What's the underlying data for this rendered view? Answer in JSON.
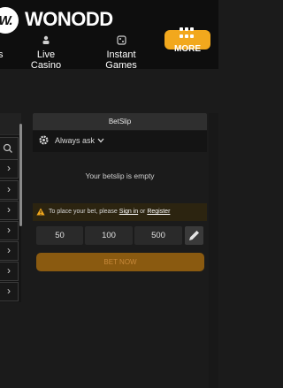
{
  "brand": {
    "mark": "W.",
    "name": "WONODD"
  },
  "nav": {
    "cut_label": "s",
    "items": [
      {
        "label": "Live Casino",
        "icon": "dealer-icon"
      },
      {
        "label": "Instant Games",
        "icon": "dice-icon"
      }
    ],
    "more_label": "MORE"
  },
  "betslip": {
    "title": "BetSlip",
    "odds_option": "Always ask",
    "empty_message": "Your betslip is empty",
    "warning": {
      "prefix": "To place your bet, please",
      "signin": "Sign in",
      "or": "or",
      "register": "Register"
    },
    "stakes": [
      "50",
      "100",
      "500"
    ],
    "bet_now_label": "BET NOW"
  },
  "colors": {
    "accent": "#f2a81d",
    "bet_now_disabled": "#8a5a10",
    "header_bg": "#0e0e0e"
  }
}
